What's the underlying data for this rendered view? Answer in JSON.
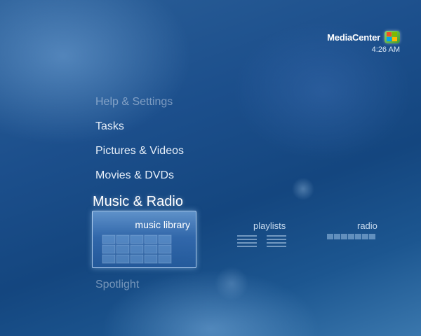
{
  "brand": {
    "name": "MediaCenter",
    "time": "4:26 AM"
  },
  "menu": {
    "help": "Help & Settings",
    "tasks": "Tasks",
    "pictures": "Pictures & Videos",
    "movies": "Movies & DVDs",
    "music": "Music & Radio",
    "spotlight": "Spotlight"
  },
  "strip": {
    "music_library": "music library",
    "playlists": "playlists",
    "radio": "radio"
  },
  "icons": {
    "brand": "windows-flag-icon",
    "library": "album-grid-icon",
    "playlists": "list-lines-icon",
    "radio": "equalizer-icon"
  }
}
